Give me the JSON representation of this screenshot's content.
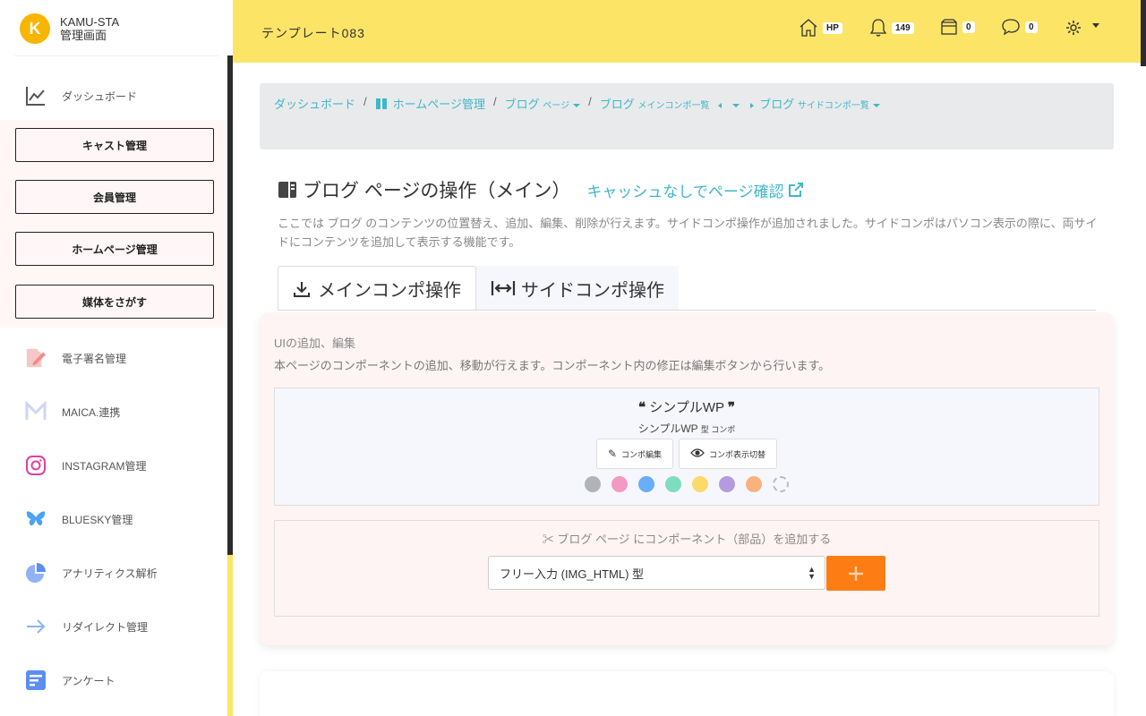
{
  "app": {
    "logo_line1": "KAMU-STA",
    "logo_line2": "管理画面",
    "logo_letter": "K"
  },
  "sidebar": {
    "dashboard": "ダッシュボード",
    "group_buttons": [
      "キャスト管理",
      "会員管理",
      "ホームページ管理",
      "媒体をさがす"
    ],
    "items": [
      {
        "label": "電子署名管理",
        "icon": "signature-icon"
      },
      {
        "label": "MAICA.連携",
        "icon": "m-logo-icon"
      },
      {
        "label": "INSTAGRAM管理",
        "icon": "instagram-icon"
      },
      {
        "label": "BLUESKY管理",
        "icon": "butterfly-icon"
      },
      {
        "label": "アナリティクス解析",
        "icon": "pie-chart-icon"
      },
      {
        "label": "リダイレクト管理",
        "icon": "arrow-right-icon"
      },
      {
        "label": "アンケート",
        "icon": "form-icon"
      }
    ]
  },
  "header": {
    "title": "テンプレート083",
    "hp_badge": "HP",
    "notifications": "149",
    "box_count": "0",
    "messages": "0"
  },
  "breadcrumb": {
    "dashboard": "ダッシュボード",
    "homepage": "ホームページ管理",
    "blog_page_a": "ブログ",
    "blog_page_b": "ページ",
    "blog_main_a": "ブログ",
    "blog_main_b": "メインコンポ一覧",
    "blog_side_a": "ブログ",
    "blog_side_b": "サイドコンポ一覧"
  },
  "page": {
    "title": "ブログ ページの操作（メイン）",
    "link": "キャッシュなしでページ確認",
    "description": "ここでは ブログ のコンテンツの位置替え、追加、編集、削除が行えます。サイドコンポ操作が追加されました。サイドコンポはパソコン表示の際に、両サイドにコンテンツを追加して表示する機能です。"
  },
  "tabs": {
    "main": "メインコンポ操作",
    "side": "サイドコンポ操作"
  },
  "card": {
    "heading": "UIの追加、編集",
    "subheading": "本ページのコンポーネントの追加、移動が行えます。コンポーネント内の修正は編集ボタンから行います。",
    "component": {
      "name": "シンプルWP",
      "sub_main": "シンプルWP",
      "sub_small": "型 コンポ",
      "edit_label": "コンポ編集",
      "toggle_label": "コンポ表示切替",
      "colors": [
        "#b0b3b8",
        "#f29ac4",
        "#6aaef7",
        "#7fdcbf",
        "#fbd96b",
        "#b49be0",
        "#f8b27e"
      ]
    },
    "add_label": "ブログ ページ にコンポーネント（部品）を追加する",
    "select_value": "フリー入力 (IMG_HTML) 型"
  },
  "colors": {
    "header_bg": "#fce566",
    "accent": "#3fb7c7",
    "add_button": "#fd7d14"
  }
}
